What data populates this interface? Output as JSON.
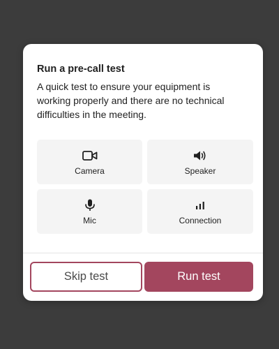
{
  "dialog": {
    "title": "Run a pre-call test",
    "description": "A quick test to ensure your equipment is working properly and there are no technical difficulties in the meeting."
  },
  "tests": [
    {
      "label": "Camera",
      "icon": "camera-icon"
    },
    {
      "label": "Speaker",
      "icon": "speaker-icon"
    },
    {
      "label": "Mic",
      "icon": "mic-icon"
    },
    {
      "label": "Connection",
      "icon": "signal-bars-icon"
    }
  ],
  "actions": {
    "skip_label": "Skip test",
    "run_label": "Run test"
  },
  "colors": {
    "backdrop": "#3c3c3c",
    "accent": "#a3465e",
    "tile_bg": "#f4f4f4"
  }
}
